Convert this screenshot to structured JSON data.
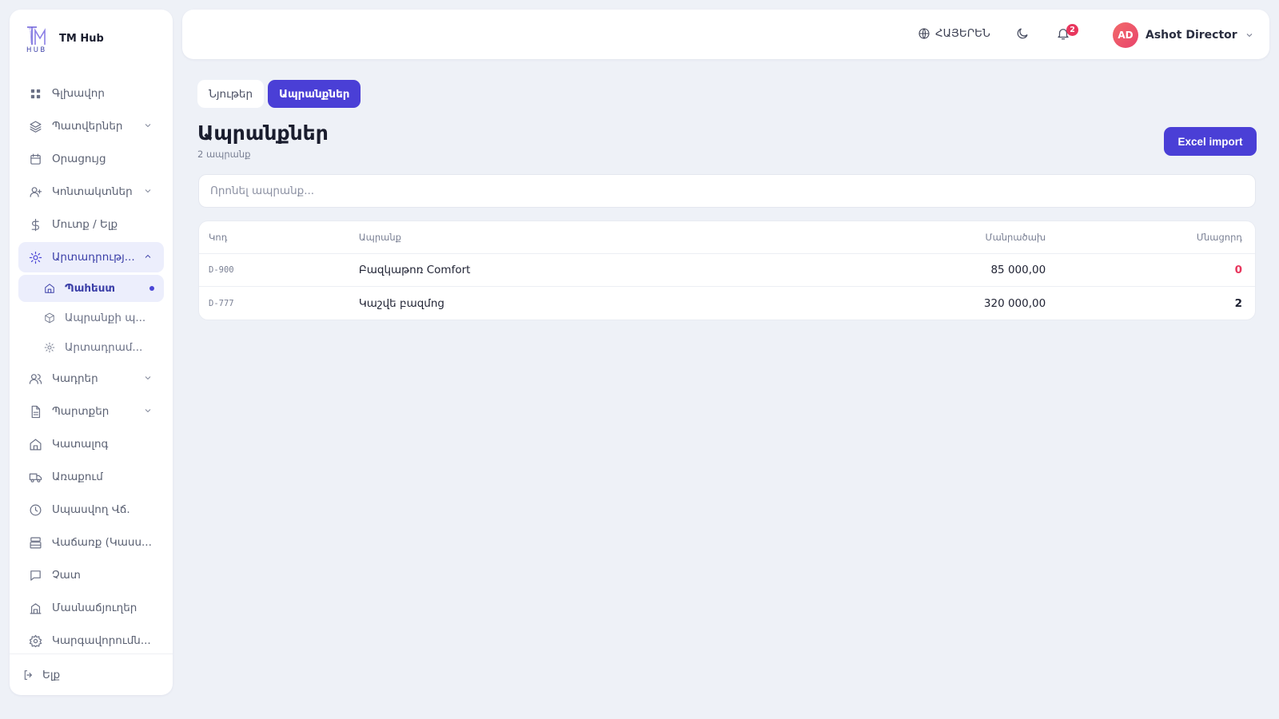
{
  "brand": {
    "name": "TM Hub",
    "logo_sub": "HUB"
  },
  "sidebar": {
    "items": [
      {
        "label": "Գլխավոր",
        "icon": "grid-icon"
      },
      {
        "label": "Պատվերներ",
        "icon": "layers-icon"
      },
      {
        "label": "Օրացույց",
        "icon": "calendar-icon"
      },
      {
        "label": "Կոնտակտներ",
        "icon": "user-plus-icon"
      },
      {
        "label": "Մուտք / Ելք",
        "icon": "dollar-icon"
      },
      {
        "label": "Արտադրությ...",
        "icon": "sun-gear-icon"
      },
      {
        "label": "Կադրեր",
        "icon": "users-icon"
      },
      {
        "label": "Պարտքեր",
        "icon": "document-icon"
      },
      {
        "label": "Կատալոգ",
        "icon": "home-icon"
      },
      {
        "label": "Առաքում",
        "icon": "truck-icon"
      },
      {
        "label": "Սպասվող Վճ.",
        "icon": "clock-icon"
      },
      {
        "label": "Վաճառք (Կասս...",
        "icon": "register-icon"
      },
      {
        "label": "Չատ",
        "icon": "chat-icon"
      },
      {
        "label": "Մասնաճյուղեր",
        "icon": "building-icon"
      },
      {
        "label": "Կարգավորումն...",
        "icon": "settings-icon"
      }
    ],
    "production_sub": [
      {
        "label": "Պահեստ",
        "icon": "warehouse-icon"
      },
      {
        "label": "Ապրանքի պ...",
        "icon": "box-icon"
      },
      {
        "label": "Արտադրամ...",
        "icon": "gear-small-icon"
      }
    ],
    "logout_label": "Ելք"
  },
  "header": {
    "language": "ՀԱՅԵՐԵՆ",
    "notifications_count": "2",
    "user_initials": "AD",
    "user_name": "Ashot Director"
  },
  "tabs": [
    {
      "label": "Նյութեր"
    },
    {
      "label": "Ապրանքներ"
    }
  ],
  "page": {
    "title": "Ապրանքներ",
    "subtitle": "2 ապրանք",
    "import_button": "Excel import",
    "search_placeholder": "Որոնել ապրանք..."
  },
  "table": {
    "columns": [
      "Կոդ",
      "Ապրանք",
      "Մանրածախ",
      "Մնացորդ"
    ],
    "rows": [
      {
        "code": "D-900",
        "name": "Բազկաթոռ Comfort",
        "price": "85 000,00",
        "stock": "0"
      },
      {
        "code": "D-777",
        "name": "Կաշվե բազմոց",
        "price": "320 000,00",
        "stock": "2"
      }
    ]
  },
  "colors": {
    "accent": "#4a3fd6",
    "danger": "#e8365d",
    "background": "#eef1f7"
  }
}
